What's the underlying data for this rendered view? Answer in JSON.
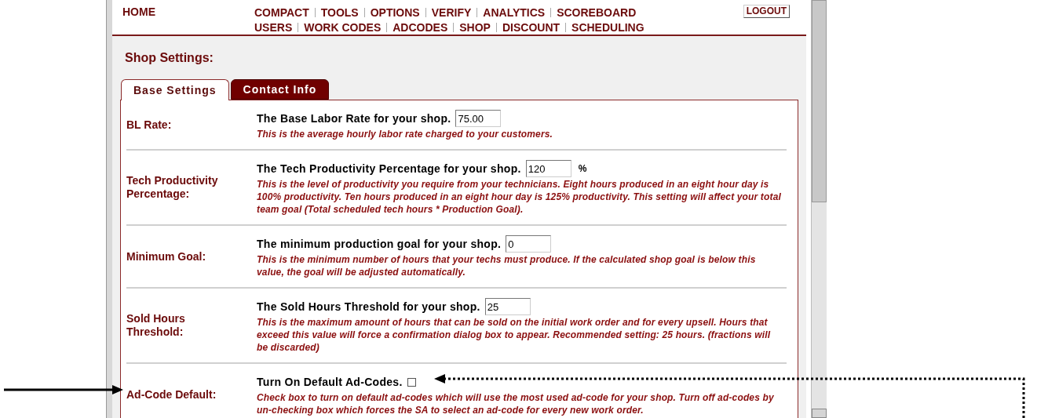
{
  "nav": {
    "home": "HOME",
    "rows": [
      [
        "COMPACT",
        "TOOLS",
        "OPTIONS",
        "VERIFY",
        "ANALYTICS",
        "SCOREBOARD"
      ],
      [
        "USERS",
        "WORK CODES",
        "ADCODES",
        "SHOP",
        "DISCOUNT",
        "SCHEDULING"
      ]
    ],
    "logout": "LOGOUT"
  },
  "page_title": "Shop Settings:",
  "tabs": [
    {
      "label": "Base Settings",
      "selected": true
    },
    {
      "label": "Contact Info",
      "selected": false
    }
  ],
  "settings": [
    {
      "kind": "input",
      "label": "BL Rate:",
      "prompt": "The Base Labor Rate for your shop.",
      "value": "75.00",
      "description": "This is the average hourly labor rate charged to your customers."
    },
    {
      "kind": "input",
      "label": "Tech Productivity Percentage:",
      "prompt": "The Tech Productivity Percentage for your shop.",
      "value": "120",
      "unit": "%",
      "description": "This is the level of productivity you require from your technicians. Eight hours produced in an eight hour day is 100% productivity. Ten hours produced in an eight hour day is 125% productivity. This setting will affect your total team goal (Total scheduled tech hours * Production Goal)."
    },
    {
      "kind": "input",
      "label": "Minimum Goal:",
      "prompt": "The minimum production goal for your shop.",
      "value": "0",
      "description": "This is the minimum number of hours that your techs must produce. If the calculated shop goal is below this value, the goal will be adjusted automatically."
    },
    {
      "kind": "input",
      "label": "Sold Hours Threshold:",
      "prompt": "The Sold Hours Threshold for your shop.",
      "value": "25",
      "description": "This is the maximum amount of hours that can be sold on the initial work order and for every upsell. Hours that exceed this value will force a confirmation dialog box to appear. Recommended setting: 25 hours. (fractions will be discarded)"
    },
    {
      "kind": "checkbox",
      "label": "Ad-Code Default:",
      "prompt": "Turn On Default Ad-Codes.",
      "checked": false,
      "description": "Check box to turn on default ad-codes which will use the most used ad-code for your shop. Turn off ad-codes by un-checking box which forces the SA to select an ad-code for every new work order."
    }
  ]
}
